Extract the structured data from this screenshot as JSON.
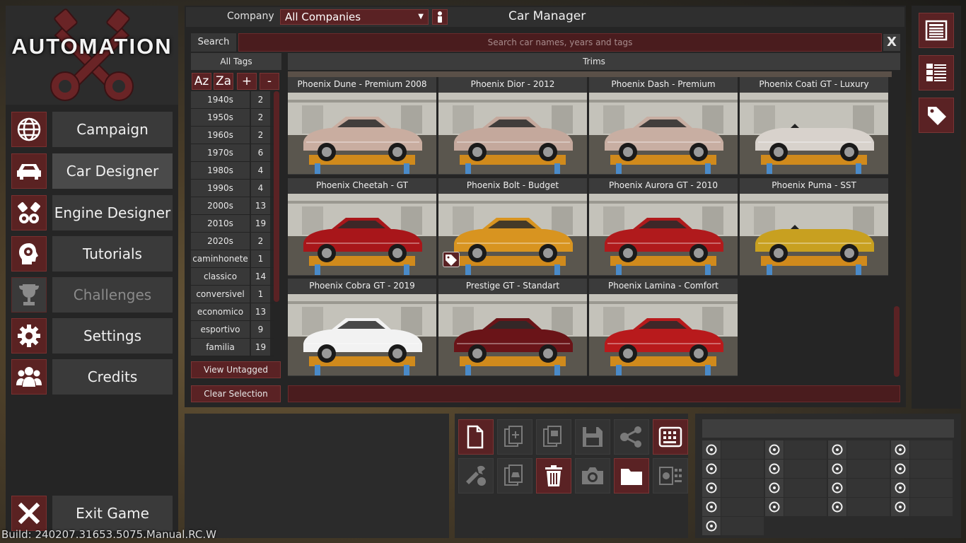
{
  "app": {
    "logo_text": "AUTOMATION",
    "build": "Build: 240207.31653.5075.Manual.RC.W",
    "accent_color": "#5a2224"
  },
  "nav": {
    "items": [
      {
        "label": "Campaign",
        "icon": "globe-icon"
      },
      {
        "label": "Car Designer",
        "icon": "car-icon"
      },
      {
        "label": "Engine Designer",
        "icon": "engine-icon"
      },
      {
        "label": "Tutorials",
        "icon": "head-gear-icon"
      },
      {
        "label": "Challenges",
        "icon": "trophy-icon"
      },
      {
        "label": "Settings",
        "icon": "gear-icon"
      },
      {
        "label": "Credits",
        "icon": "people-icon"
      }
    ],
    "exit_label": "Exit Game"
  },
  "manager": {
    "title": "Car Manager",
    "company_label": "Company",
    "company_value": "All Companies",
    "search_label": "Search",
    "search_placeholder": "Search car names, years and tags",
    "search_clear": "X",
    "tags_header": "All Tags",
    "trims_header": "Trims",
    "sort_buttons": [
      "Az",
      "Za",
      "+",
      "-"
    ],
    "tags": [
      {
        "name": "1940s",
        "count": "2"
      },
      {
        "name": "1950s",
        "count": "2"
      },
      {
        "name": "1960s",
        "count": "2"
      },
      {
        "name": "1970s",
        "count": "6"
      },
      {
        "name": "1980s",
        "count": "4"
      },
      {
        "name": "1990s",
        "count": "4"
      },
      {
        "name": "2000s",
        "count": "13"
      },
      {
        "name": "2010s",
        "count": "19"
      },
      {
        "name": "2020s",
        "count": "2"
      },
      {
        "name": "caminhonete",
        "count": "1"
      },
      {
        "name": "classico",
        "count": "14"
      },
      {
        "name": "conversivel",
        "count": "1"
      },
      {
        "name": "economico",
        "count": "13"
      },
      {
        "name": "esportivo",
        "count": "9"
      },
      {
        "name": "familia",
        "count": "19"
      }
    ],
    "view_untagged": "View Untagged",
    "clear_selection": "Clear Selection",
    "trims": [
      {
        "name": "Phoenix Dune - Premium 2008",
        "color": "#c9ada0",
        "tagged": false
      },
      {
        "name": "Phoenix Dior - 2012",
        "color": "#c4a89c",
        "tagged": false
      },
      {
        "name": "Phoenix Dash - Premium",
        "color": "#c8aea2",
        "tagged": false
      },
      {
        "name": "Phoenix Coati GT - Luxury",
        "color": "#d8d2cc",
        "tagged": false
      },
      {
        "name": "Phoenix Cheetah - GT",
        "color": "#a8161a",
        "tagged": false
      },
      {
        "name": "Phoenix Bolt - Budget",
        "color": "#d89420",
        "tagged": true
      },
      {
        "name": "Phoenix Aurora GT - 2010",
        "color": "#b01a1c",
        "tagged": false
      },
      {
        "name": "Phoenix Puma - SST",
        "color": "#c8a020",
        "tagged": false
      },
      {
        "name": "Phoenix Cobra GT - 2019",
        "color": "#f2f2f2",
        "tagged": false
      },
      {
        "name": "Prestige GT - Standart",
        "color": "#6a1418",
        "tagged": false
      },
      {
        "name": "Phoenix Lamina - Comfort",
        "color": "#b81a1c",
        "tagged": false
      }
    ]
  },
  "right_panel": {
    "buttons": [
      "list-view-icon",
      "grid-view-icon",
      "tag-icon"
    ]
  },
  "actions": {
    "buttons": [
      {
        "icon": "new-file-icon",
        "style": "red"
      },
      {
        "icon": "add-file-icon",
        "style": "dim"
      },
      {
        "icon": "copy-file-icon",
        "style": "dim"
      },
      {
        "icon": "save-icon",
        "style": "dim"
      },
      {
        "icon": "share-icon",
        "style": "dim"
      },
      {
        "icon": "multi-select-icon",
        "style": "red"
      },
      {
        "icon": "tool-icon",
        "style": "dim"
      },
      {
        "icon": "duplicate-car-icon",
        "style": "dim"
      },
      {
        "icon": "trash-icon",
        "style": "red"
      },
      {
        "icon": "camera-icon",
        "style": "dim"
      },
      {
        "icon": "folder-icon",
        "style": "red"
      },
      {
        "icon": "export-icon",
        "style": "dim"
      }
    ]
  },
  "stats": {
    "icons": [
      "steering-wheel-icon",
      "passengers-icon",
      "move-icon",
      "fuel-can-icon",
      "race-flag-icon",
      "cargo-car-icon",
      "size-icon",
      "eco-engine-icon",
      "seat-icon",
      "offroad-car-icon",
      "safety-icon",
      "fuel-pump-icon",
      "prestige-icon",
      "reliability-icon",
      "service-icon",
      "balance-icon",
      "chevron-icon"
    ]
  }
}
